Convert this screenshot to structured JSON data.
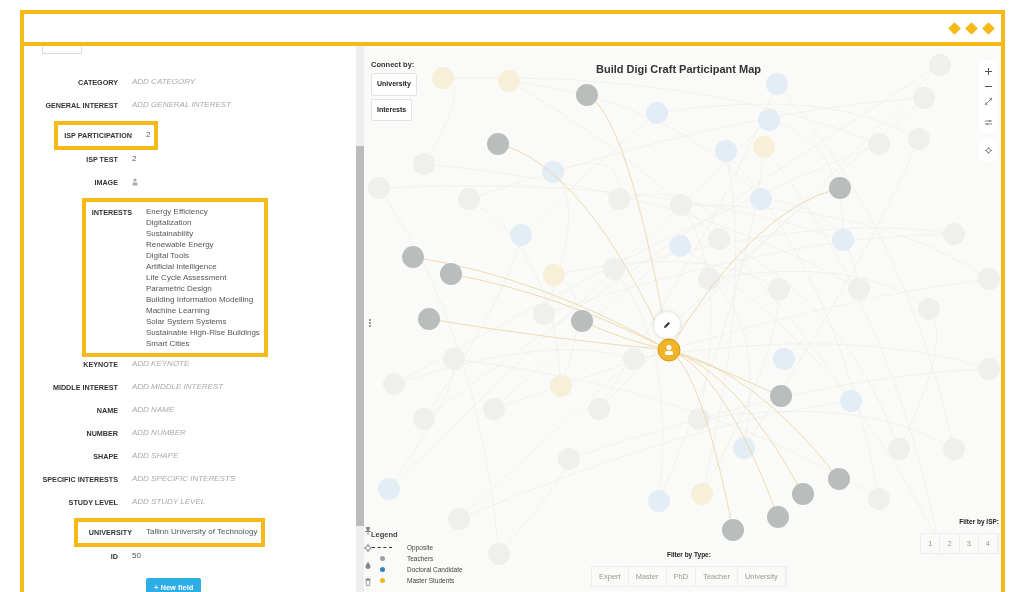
{
  "record": {
    "fields": [
      {
        "label": "CATEGORY",
        "kind": "empty",
        "placeholder": "ADD CATEGORY",
        "highlighted": false
      },
      {
        "label": "GENERAL INTEREST",
        "kind": "empty",
        "placeholder": "ADD GENERAL INTEREST",
        "highlighted": false
      },
      {
        "label": "ISP PARTICIPATION",
        "kind": "text",
        "value": "2",
        "highlighted": true
      },
      {
        "label": "ISP TEST",
        "kind": "text",
        "value": "2",
        "highlighted": false
      },
      {
        "label": "IMAGE",
        "kind": "image",
        "highlighted": false
      },
      {
        "label": "INTERESTS",
        "kind": "list",
        "highlighted": true,
        "items": [
          "Energy Efficiency",
          "Digitalization",
          "Sustainability",
          "Renewable Energy",
          "Digital Tools",
          "Artificial Intelligence",
          "Life Cycle Assessment",
          "Parametric Design",
          "Building Information Modelling",
          "Machine Learning",
          "Solar System Systems",
          "Sustainable High-Rise Buildings",
          "Smart Cities"
        ]
      },
      {
        "label": "KEYNOTE",
        "kind": "empty",
        "placeholder": "ADD KEYNOTE",
        "highlighted": false
      },
      {
        "label": "MIDDLE INTEREST",
        "kind": "empty",
        "placeholder": "ADD MIDDLE INTEREST",
        "highlighted": false
      },
      {
        "label": "NAME",
        "kind": "empty",
        "placeholder": "ADD NAME",
        "highlighted": false
      },
      {
        "label": "NUMBER",
        "kind": "empty",
        "placeholder": "ADD NUMBER",
        "highlighted": false
      },
      {
        "label": "SHAPE",
        "kind": "empty",
        "placeholder": "ADD SHAPE",
        "highlighted": false
      },
      {
        "label": "SPECIFIC INTERESTS",
        "kind": "empty",
        "placeholder": "ADD SPECIFIC INTERESTS",
        "highlighted": false
      },
      {
        "label": "STUDY LEVEL",
        "kind": "empty",
        "placeholder": "ADD STUDY LEVEL",
        "highlighted": false
      },
      {
        "label": "UNIVERSITY",
        "kind": "text",
        "value": "Tallinn University of Technology",
        "highlighted": true
      },
      {
        "label": "ID",
        "kind": "text",
        "value": "50",
        "highlighted": false
      }
    ],
    "new_field_button": "+ New field"
  },
  "map": {
    "title": "Build Digi Craft Participant Map",
    "connect_by": {
      "label": "Connect by:",
      "options": [
        "University",
        "Interests"
      ]
    },
    "legend": {
      "title": "Legend",
      "items": [
        {
          "kind": "dashed",
          "label": "Opposite"
        },
        {
          "kind": "dot",
          "label": "Teachers",
          "color": "#9aa3a0"
        },
        {
          "kind": "dot",
          "label": "Doctoral Candidate",
          "color": "#2e86c1"
        },
        {
          "kind": "dot",
          "label": "Master Students",
          "color": "#f0b429"
        }
      ]
    },
    "filter_type": {
      "label": "Filter by Type:",
      "options": [
        "Expert",
        "Master",
        "PhD",
        "Teacher",
        "University"
      ]
    },
    "filter_isp": {
      "label": "Filter by ISP:",
      "options": [
        "1",
        "2",
        "3",
        "4"
      ]
    }
  }
}
